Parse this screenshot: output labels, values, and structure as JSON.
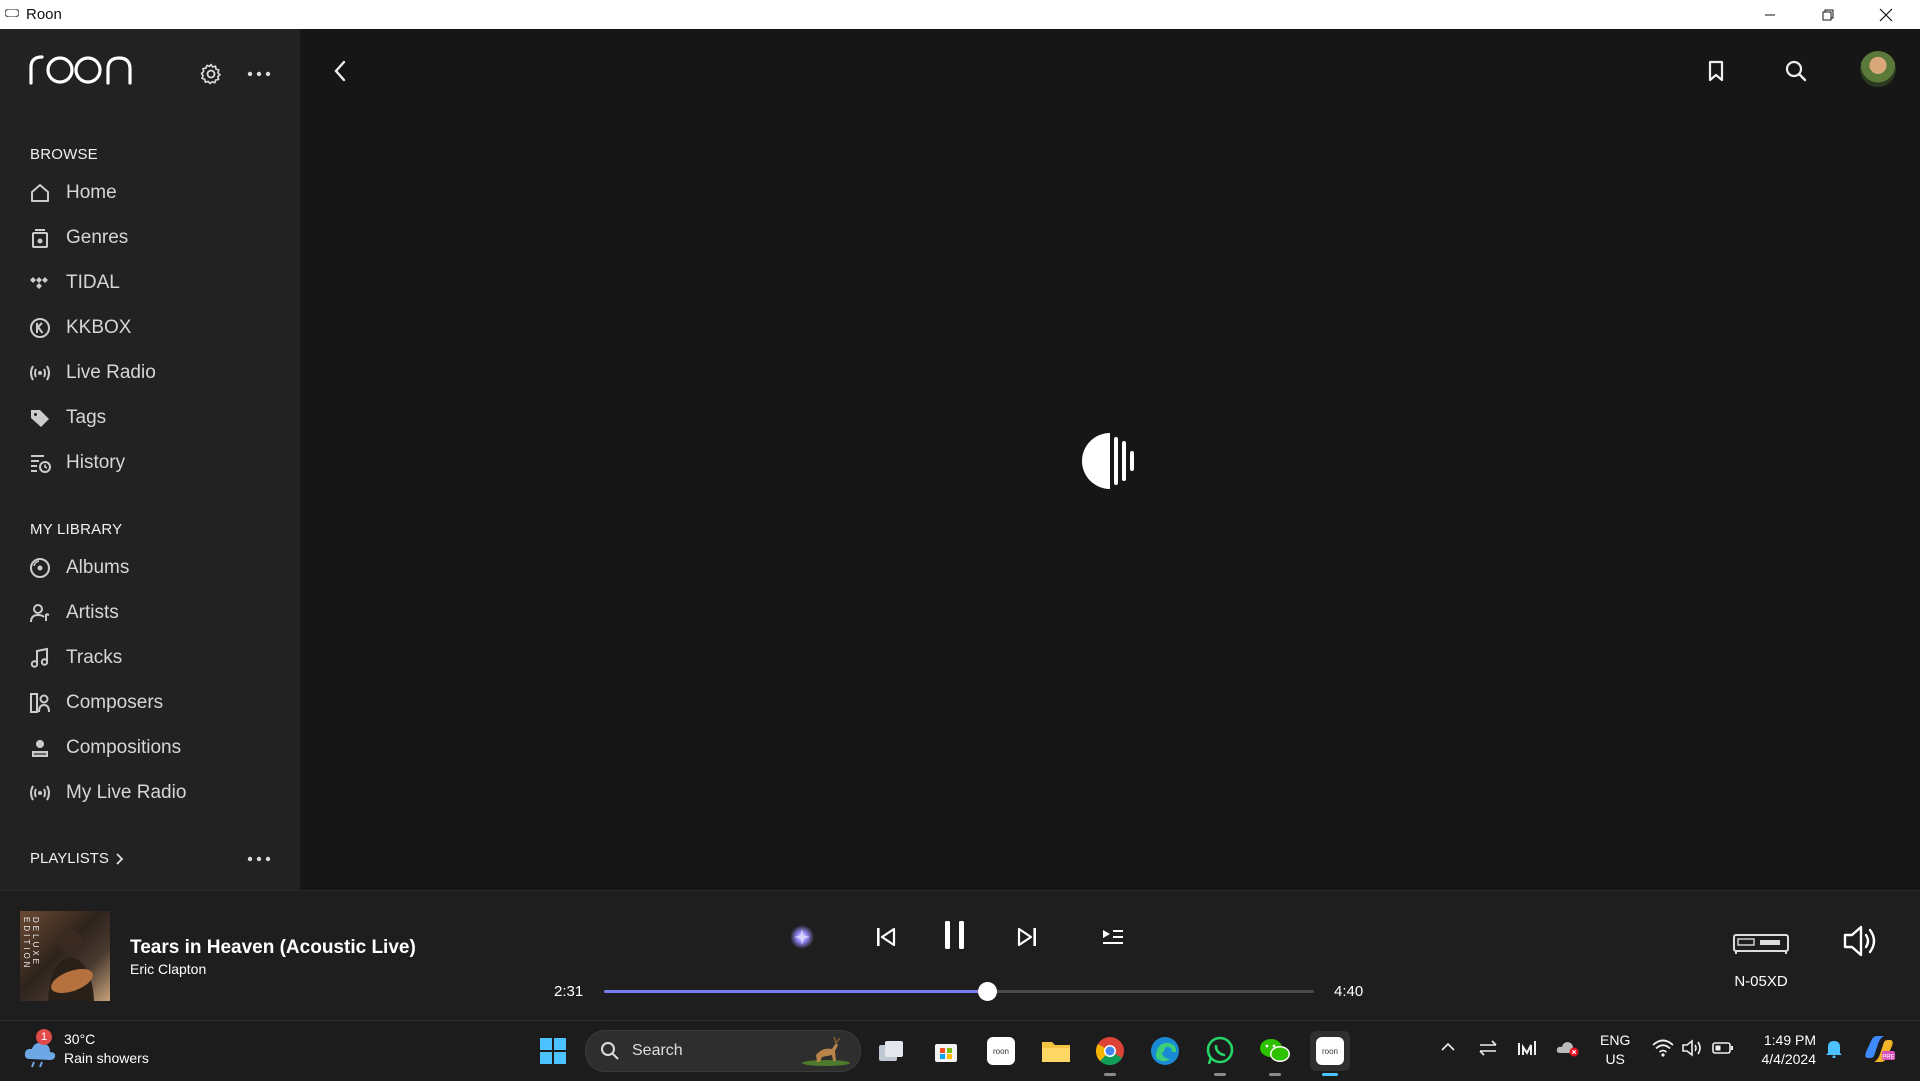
{
  "window": {
    "title": "Roon"
  },
  "brand": {
    "logo_text": "roon"
  },
  "sidebar": {
    "browse_label": "BROWSE",
    "browse_items": [
      {
        "label": "Home",
        "icon": "home-icon"
      },
      {
        "label": "Genres",
        "icon": "genres-icon"
      },
      {
        "label": "TIDAL",
        "icon": "tidal-icon"
      },
      {
        "label": "KKBOX",
        "icon": "kkbox-icon"
      },
      {
        "label": "Live Radio",
        "icon": "radio-icon"
      },
      {
        "label": "Tags",
        "icon": "tag-icon"
      },
      {
        "label": "History",
        "icon": "history-icon"
      }
    ],
    "library_label": "MY LIBRARY",
    "library_items": [
      {
        "label": "Albums",
        "icon": "album-icon"
      },
      {
        "label": "Artists",
        "icon": "artist-icon"
      },
      {
        "label": "Tracks",
        "icon": "music-note-icon"
      },
      {
        "label": "Composers",
        "icon": "composer-icon"
      },
      {
        "label": "Compositions",
        "icon": "composition-icon"
      },
      {
        "label": "My Live Radio",
        "icon": "radio-icon"
      }
    ],
    "playlists_label": "PLAYLISTS"
  },
  "now_playing": {
    "title": "Tears in Heaven (Acoustic Live)",
    "artist": "Eric Clapton",
    "elapsed": "2:31",
    "duration": "4:40",
    "progress_fraction": 0.54,
    "cover_text": "DELUXE EDITION",
    "device": "N-05XD"
  },
  "taskbar": {
    "weather": {
      "badge": "1",
      "temp": "30°C",
      "desc": "Rain showers"
    },
    "search_placeholder": "Search",
    "lang": {
      "line1": "ENG",
      "line2": "US"
    },
    "clock": {
      "time": "1:49 PM",
      "date": "4/4/2024"
    }
  },
  "colors": {
    "accent": "#7b7ef2",
    "sidebar_bg": "#222222",
    "main_bg": "#161616"
  }
}
